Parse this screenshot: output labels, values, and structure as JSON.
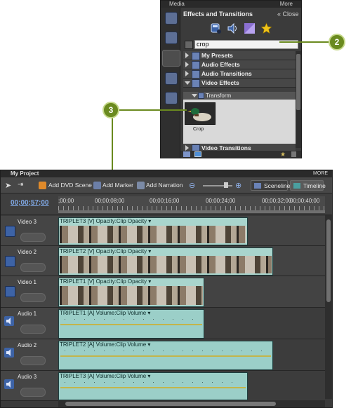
{
  "media_panel": {
    "tab_label": "Media",
    "more_label": "More",
    "title": "Effects and Transitions",
    "close_label": "Close",
    "search_value": "crop",
    "categories": [
      {
        "label": "My Presets"
      },
      {
        "label": "Audio Effects"
      },
      {
        "label": "Audio Transitions"
      },
      {
        "label": "Video Effects"
      },
      {
        "label": "Video Transitions"
      }
    ],
    "subcategory": "Transform",
    "effect_item": "Crop"
  },
  "callouts": {
    "step2": "2",
    "step3": "3"
  },
  "project": {
    "title": "My Project",
    "more_label": "MORE",
    "toolbar": {
      "add_dvd_scene": "Add DVD Scene",
      "add_marker": "Add Marker",
      "add_narration": "Add Narration",
      "sceneline": "Sceneline",
      "timeline": "Timeline"
    },
    "timecode": "00;00;57;00",
    "ruler_labels": [
      ";00;00",
      "00;00;08;00",
      "00;00;16;00",
      "00;00;24;00",
      "00;00;32;00",
      "00;00;40;00"
    ],
    "tracks": [
      {
        "name": "Video 3",
        "clip_label": "TRIPLET3 [V]  Opacity:Clip Opacity ▾"
      },
      {
        "name": "Video 2",
        "clip_label": "TRIPLET2 [V]  Opacity:Clip Opacity ▾"
      },
      {
        "name": "Video 1",
        "clip_label": "TRIPLET1 [V]  Opacity:Clip Opacity ▾"
      },
      {
        "name": "Audio 1",
        "clip_label": "TRIPLET1 [A]  Volume:Clip Volume ▾"
      },
      {
        "name": "Audio 2",
        "clip_label": "TRIPLET2 [A]  Volume:Clip Volume ▾"
      },
      {
        "name": "Audio 3",
        "clip_label": "TRIPLET3 [A]  Volume:Clip Volume ▾"
      }
    ]
  },
  "colors": {
    "callout": "#6a8a1f",
    "timecode": "#7fa7e3",
    "clip": "#a9d5cd"
  }
}
